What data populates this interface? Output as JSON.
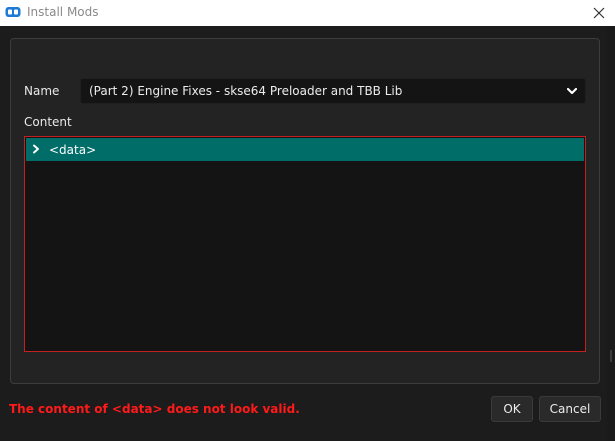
{
  "window": {
    "title": "Install Mods",
    "close_icon": "close-icon",
    "app_icon": "mod-organizer-icon"
  },
  "form": {
    "name_label": "Name",
    "name_value": "(Part 2) Engine Fixes - skse64 Preloader and TBB Lib",
    "content_label": "Content"
  },
  "tree": {
    "items": [
      {
        "label": "<data>",
        "selected": true,
        "expanded": false
      }
    ]
  },
  "status": {
    "error_message": "The content of <data> does not look valid."
  },
  "buttons": {
    "ok_label": "OK",
    "cancel_label": "Cancel"
  },
  "colors": {
    "selection": "#006d68",
    "error": "#ff1a1a",
    "invalid_border": "#c42020"
  }
}
